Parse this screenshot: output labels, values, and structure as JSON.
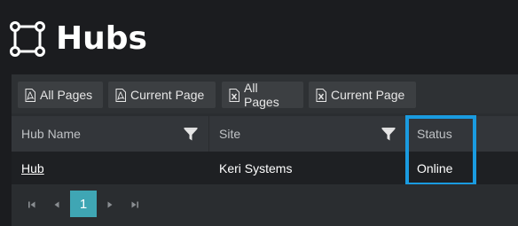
{
  "page": {
    "title": "Hubs"
  },
  "toolbar": {
    "buttons": [
      {
        "label": "All Pages",
        "icon": "pdf-icon"
      },
      {
        "label": "Current Page",
        "icon": "pdf-icon"
      },
      {
        "label": "All Pages",
        "icon": "excel-icon"
      },
      {
        "label": "Current Page",
        "icon": "excel-icon"
      }
    ]
  },
  "table": {
    "columns": [
      "Hub Name",
      "Site",
      "Status"
    ],
    "rows": [
      {
        "hub_name": "Hub",
        "site": "Keri Systems",
        "status": "Online"
      }
    ],
    "highlighted_column": "Status"
  },
  "pager": {
    "current_page": "1"
  },
  "colors": {
    "background": "#1b1c1f",
    "toolbar": "#2e3134",
    "button": "#3c3f42",
    "header_row": "#33363a",
    "row": "#1e2023",
    "active_page": "#3fa6b4",
    "highlight_border": "#1a9be0"
  }
}
